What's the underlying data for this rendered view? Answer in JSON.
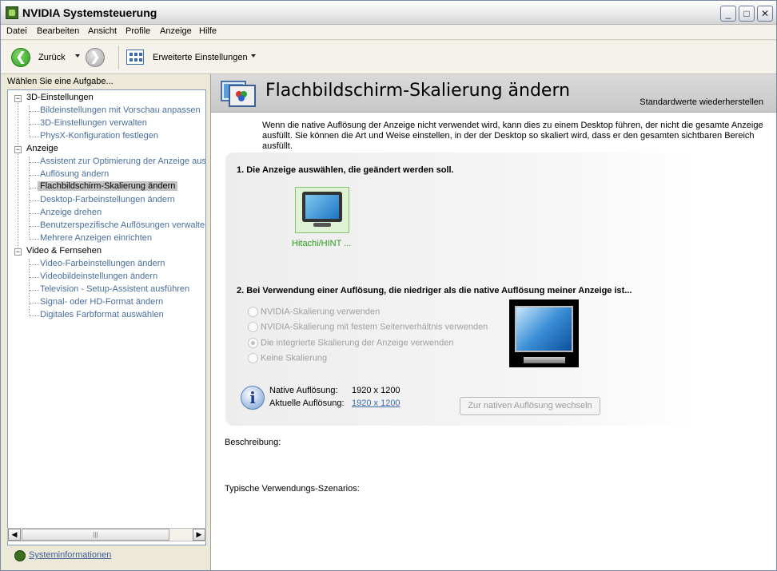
{
  "window": {
    "title": "NVIDIA Systemsteuerung",
    "minimize": "_",
    "maximize": "□",
    "close": "✕"
  },
  "menu": [
    "Datei",
    "Bearbeiten",
    "Ansicht",
    "Profile",
    "Anzeige",
    "Hilfe"
  ],
  "toolbar": {
    "back_label": "Zurück",
    "advanced_label": "Erweiterte Einstellungen",
    "back_glyph": "❮",
    "forward_glyph": "❯"
  },
  "sidebar": {
    "header": "Wählen Sie eine Aufgabe...",
    "categories": [
      {
        "label": "3D-Einstellungen",
        "expander": "−",
        "items": [
          "Bildeinstellungen mit Vorschau anpassen",
          "3D-Einstellungen verwalten",
          "PhysX-Konfiguration festlegen"
        ]
      },
      {
        "label": "Anzeige",
        "expander": "−",
        "items": [
          "Assistent zur Optimierung der Anzeige ausf",
          "Auflösung ändern",
          "Flachbildschirm-Skalierung ändern",
          "Desktop-Farbeinstellungen ändern",
          "Anzeige drehen",
          "Benutzerspezifische Auflösungen verwalter",
          "Mehrere Anzeigen einrichten"
        ]
      },
      {
        "label": "Video & Fernsehen",
        "expander": "−",
        "items": [
          "Video-Farbeinstellungen ändern",
          "Videobildeinstellungen ändern",
          "Television - Setup-Assistent ausführen",
          "Signal- oder HD-Format ändern",
          "Digitales Farbformat auswählen"
        ]
      }
    ],
    "selected": "Flachbildschirm-Skalierung ändern",
    "scroll_left": "◀",
    "scroll_right": "▶",
    "scroll_grip": "|||",
    "sysinfo_label": "Systeminformationen"
  },
  "page": {
    "title": "Flachbildschirm-Skalierung ändern",
    "restore_defaults": "Standardwerte wiederherstellen",
    "intro": "Wenn die native Auflösung der Anzeige nicht verwendet wird, kann dies zu einem Desktop führen, der nicht die gesamte Anzeige ausfüllt. Sie können die Art und Weise einstellen, in der der Desktop so skaliert wird, dass er den gesamten sichtbaren Bereich ausfüllt.",
    "step1": "1. Die Anzeige auswählen, die geändert werden soll.",
    "display_name": "Hitachi/HINT ...",
    "step2": "2. Bei Verwendung einer Auflösung, die niedriger als die native Auflösung meiner Anzeige ist...",
    "options": [
      {
        "label": "NVIDIA-Skalierung verwenden",
        "checked": false
      },
      {
        "label": "NVIDIA-Skalierung mit festem Seitenverhältnis verwenden",
        "checked": false
      },
      {
        "label": "Die integrierte Skalierung der Anzeige verwenden",
        "checked": true
      },
      {
        "label": "Keine Skalierung",
        "checked": false
      }
    ],
    "info_glyph": "i",
    "native_res_label": "Native Auflösung:",
    "native_res_value": "1920 x 1200",
    "current_res_label": "Aktuelle Auflösung:",
    "current_res_value": "1920 x 1200",
    "native_button": "Zur nativen Auflösung wechseln",
    "description_label": "Beschreibung:",
    "scenarios_label": "Typische Verwendungs-Szenarios:"
  }
}
